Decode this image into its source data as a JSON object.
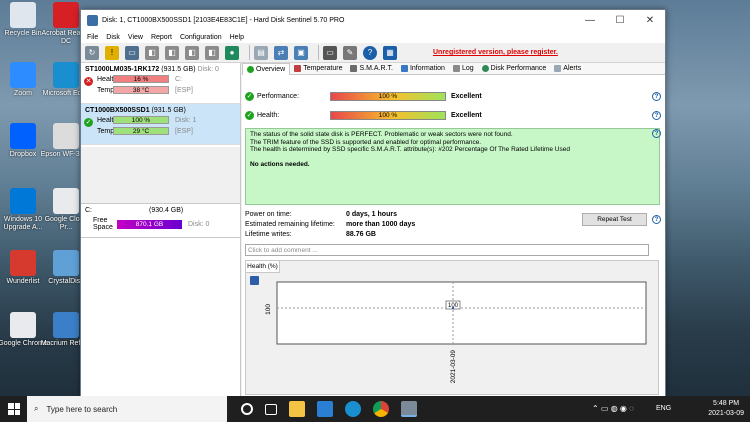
{
  "desktop": {
    "icons": [
      {
        "label": "Recycle Bin",
        "color": "#dfe6ee"
      },
      {
        "label": "Acrobat Reader DC",
        "color": "#d71f26"
      },
      {
        "label": "Zoom",
        "color": "#2d8cff"
      },
      {
        "label": "Microsoft Edge",
        "color": "#1a8fd0"
      },
      {
        "label": "Dropbox",
        "color": "#0061fe"
      },
      {
        "label": "Epson WF-3720",
        "color": "#dcdcdc"
      },
      {
        "label": "Windows 10 Upgrade A...",
        "color": "#0078d7"
      },
      {
        "label": "Google Cloud Pr...",
        "color": "#e8eaed"
      },
      {
        "label": "Wunderlist",
        "color": "#d63a2f"
      },
      {
        "label": "CrystalDisk",
        "color": "#5fa0d6"
      },
      {
        "label": "Google Chrome",
        "color": "#e8eaed"
      },
      {
        "label": "Macrium Reflect",
        "color": "#3a7fc8"
      }
    ]
  },
  "window": {
    "title": "Disk: 1, CT1000BX500SSD1 [2103E4E83C1E]  -  Hard Disk Sentinel 5.70 PRO",
    "menu": [
      "File",
      "Disk",
      "View",
      "Report",
      "Configuration",
      "Help"
    ],
    "unregistered": "Unregistered version, please register."
  },
  "disks": [
    {
      "name": "ST1000LM035-1RK172",
      "capacity": "(931.5 GB)",
      "disk_no": "Disk: 0",
      "health_label": "Health:",
      "health": "16 %",
      "health_fraction": 0.16,
      "health_color": "#f08080",
      "drive": "C:",
      "temp_label": "Temp.:",
      "temp": "38 °C",
      "temp_color": "#f3a6a6",
      "part": "[ESP]"
    },
    {
      "name": "CT1000BX500SSD1",
      "capacity": "(931.5 GB)",
      "disk_no": "Disk: 1",
      "health_label": "Health:",
      "health": "100 %",
      "health_fraction": 1.0,
      "health_color": "#9ee07a",
      "drive": "",
      "temp_label": "Temp.:",
      "temp": "29 °C",
      "temp_color": "#9ee07a",
      "part": "[ESP]"
    }
  ],
  "volume": {
    "drive": "C:",
    "capacity": "(930.4 GB)",
    "free_label": "Free Space",
    "free": "870.1 GB",
    "disk_no": "Disk: 0"
  },
  "tabs": [
    "Overview",
    "Temperature",
    "S.M.A.R.T.",
    "Information",
    "Log",
    "Disk Performance",
    "Alerts"
  ],
  "overview": {
    "performance_label": "Performance:",
    "performance_value": "100 %",
    "performance_status": "Excellent",
    "health_label": "Health:",
    "health_value": "100 %",
    "health_status": "Excellent",
    "message": [
      "The status of the solid state disk is PERFECT. Problematic or weak sectors were not found.",
      "The TRIM feature of the SSD is supported and enabled for optimal performance.",
      "The health is determined by SSD specific S.M.A.R.T. attribute(s):  #202 Percentage Of The Rated Lifetime Used",
      "No actions needed."
    ],
    "power_on_label": "Power on time:",
    "power_on": "0 days, 1 hours",
    "lifetime_label": "Estimated remaining lifetime:",
    "lifetime": "more than 1000 days",
    "writes_label": "Lifetime writes:",
    "writes": "88.76 GB",
    "repeat_test": "Repeat Test",
    "comment_placeholder": "Click to add comment ..."
  },
  "chart_data": {
    "type": "line",
    "title": "Health (%)",
    "x": [
      "2021-03-09"
    ],
    "values": [
      100
    ],
    "ytick": "100",
    "data_label": "100"
  },
  "taskbar": {
    "search_placeholder": "Type here to search",
    "lang": "ENG",
    "time": "5:48 PM",
    "date": "2021-03-09"
  }
}
